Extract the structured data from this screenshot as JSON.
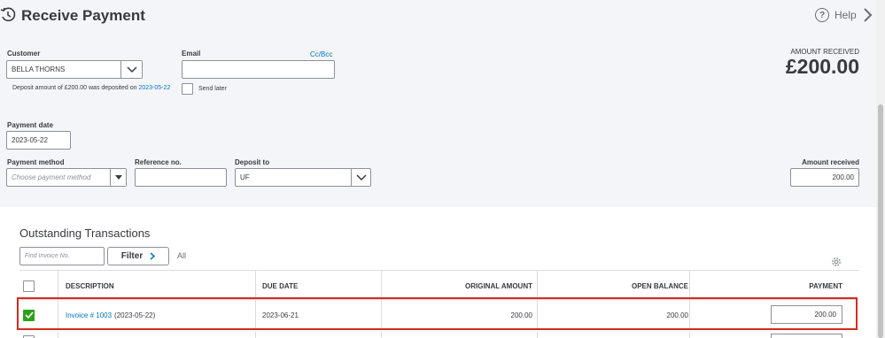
{
  "header": {
    "title": "Receive Payment",
    "help_label": "Help"
  },
  "customer": {
    "label": "Customer",
    "value": "BELLA THORNS",
    "deposit_note_prefix": "Deposit amount of £200.00 was deposited on",
    "deposit_note_date": "2023-05-22"
  },
  "email": {
    "label": "Email",
    "value": "",
    "cc_bcc": "Cc/Bcc",
    "send_later": "Send later"
  },
  "amount_received_summary": {
    "label": "AMOUNT RECEIVED",
    "value": "£200.00"
  },
  "payment_date": {
    "label": "Payment date",
    "value": "2023-05-22"
  },
  "payment_method": {
    "label": "Payment method",
    "placeholder": "Choose payment method"
  },
  "reference": {
    "label": "Reference no.",
    "value": ""
  },
  "deposit_to": {
    "label": "Deposit to",
    "value": "UF"
  },
  "amount_received_field": {
    "label": "Amount received",
    "value": "200.00"
  },
  "outstanding": {
    "title": "Outstanding Transactions",
    "find_placeholder": "Find Invoice No.",
    "filter_label": "Filter",
    "all_label": "All",
    "columns": [
      "DESCRIPTION",
      "DUE DATE",
      "ORIGINAL AMOUNT",
      "OPEN BALANCE",
      "PAYMENT"
    ],
    "rows": [
      {
        "checked": true,
        "invoice_link": "Invoice # 1003",
        "invoice_date": "(2023-05-22)",
        "due_date": "2023-06-21",
        "original_amount": "200.00",
        "open_balance": "200.00",
        "payment": "200.00"
      }
    ]
  },
  "colors": {
    "accent_link": "#0077c5",
    "checkbox_green": "#2ca01c",
    "highlight_red": "#d52b1e",
    "top_panel_bg": "#f4f5f8"
  }
}
